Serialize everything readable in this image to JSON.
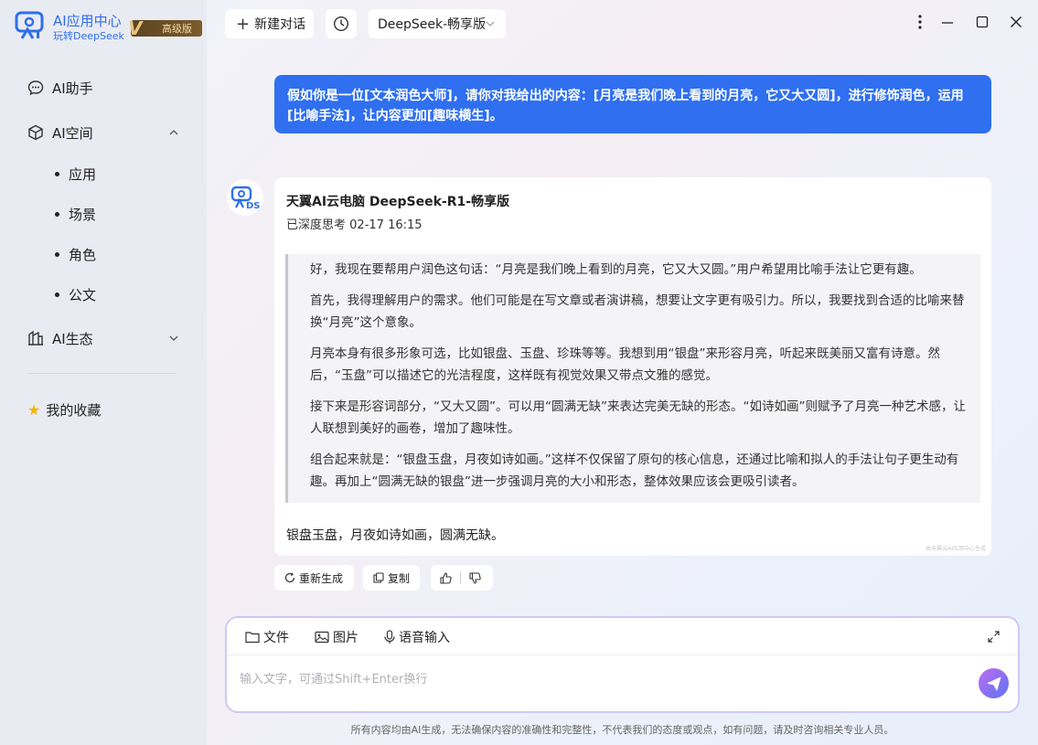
{
  "app": {
    "title": "AI应用中心",
    "subtitle": "玩转DeepSeek",
    "badge_mark": "V",
    "badge_label": "高级版"
  },
  "sidebar": {
    "assistant": "AI助手",
    "space": "AI空间",
    "space_items": [
      "应用",
      "场景",
      "角色",
      "公文"
    ],
    "ecosystem": "AI生态",
    "favorites": "我的收藏"
  },
  "topbar": {
    "new_chat": "新建对话",
    "model_select": "DeepSeek-畅享版"
  },
  "conversation": {
    "user_message": "假如你是一位[文本润色大师]，请你对我给出的内容：[月亮是我们晚上看到的月亮，它又大又圆]，进行修饰润色，运用[比喻手法]，让内容更加[趣味横生]。",
    "bot_name": "天翼AI云电脑 DeepSeek-R1-畅享版",
    "bot_status": "已深度思考",
    "bot_time": "02-17 16:15",
    "thinking": [
      "好，我现在要帮用户润色这句话：“月亮是我们晚上看到的月亮，它又大又圆。”用户希望用比喻手法让它更有趣。",
      "首先，我得理解用户的需求。他们可能是在写文章或者演讲稿，想要让文字更有吸引力。所以，我要找到合适的比喻来替换“月亮”这个意象。",
      "月亮本身有很多形象可选，比如银盘、玉盘、珍珠等等。我想到用“银盘”来形容月亮，听起来既美丽又富有诗意。然后，“玉盘”可以描述它的光洁程度，这样既有视觉效果又带点文雅的感觉。",
      "接下来是形容词部分，“又大又圆”。可以用“圆满无缺”来表达完美无缺的形态。“如诗如画”则赋予了月亮一种艺术感，让人联想到美好的画卷，增加了趣味性。",
      "组合起来就是：“银盘玉盘，月夜如诗如画。”这样不仅保留了原句的核心信息，还通过比喻和拟人的手法让句子更生动有趣。再加上“圆满无缺的银盘”进一步强调月亮的大小和形态，整体效果应该会更吸引读者。"
    ],
    "final_answer": "银盘玉盘，月夜如诗如画，圆满无缺。",
    "watermark": "由天翼云AI应用中心生成"
  },
  "actions": {
    "regenerate": "重新生成",
    "copy": "复制"
  },
  "composer": {
    "file": "文件",
    "image": "图片",
    "voice": "语音输入",
    "placeholder": "输入文字，可通过Shift+Enter换行"
  },
  "footer": {
    "disclaimer": "所有内容均由AI生成，无法确保内容的准确性和完整性，不代表我们的态度或观点，如有问题，请及时咨询相关专业人员。"
  },
  "colors": {
    "accent": "#2f6ff0",
    "sidebar_bg": "#e9ebf2",
    "badge_gold": "#e8c27a"
  }
}
